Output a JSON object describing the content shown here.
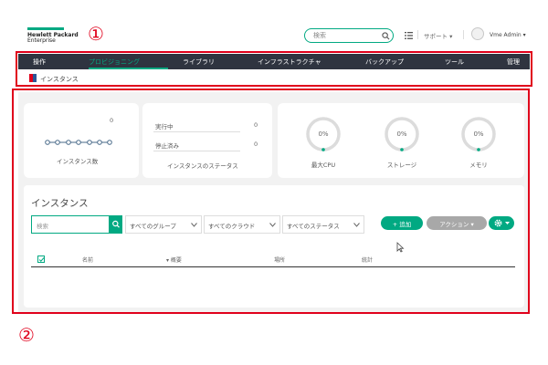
{
  "header": {
    "brand_line1": "Hewlett Packard",
    "brand_line2": "Enterprise",
    "marker_1": "①",
    "marker_2": "②",
    "search_placeholder": "検索",
    "support_label": "サポート ▾",
    "user_label": "Vme Admin ▾"
  },
  "nav": {
    "items": [
      "操作",
      "プロビジョニング",
      "ライブラリ",
      "インフラストラクチャ",
      "バックアップ",
      "ツール",
      "管理"
    ],
    "active": "プロビジョニング",
    "sub_item": "インスタンス"
  },
  "summary": {
    "instance_count": "0",
    "instance_count_label": "インスタンス数",
    "running_label": "実行中",
    "running_value": "0",
    "stopped_label": "停止済み",
    "stopped_value": "0",
    "status_label": "インスタンスのステータス",
    "gauges": [
      {
        "value": "0%",
        "label": "最大CPU",
        "fraction": 0
      },
      {
        "value": "0%",
        "label": "ストレージ",
        "fraction": 0
      },
      {
        "value": "0%",
        "label": "メモリ",
        "fraction": 0
      }
    ]
  },
  "instances": {
    "title": "インスタンス",
    "search_placeholder": "検索",
    "filters": [
      "すべてのグループ",
      "すべてのクラウド",
      "すべてのステータス"
    ],
    "add_label": "+ 追加",
    "action_label": "アクション ▾",
    "columns": [
      "名前",
      "▾ 概要",
      "場所",
      "統計"
    ]
  },
  "colors": {
    "accent": "#01a982",
    "nav_bg": "#2f3440",
    "highlight": "#e0001b",
    "content_bg": "#f2f2f2"
  },
  "icons": {
    "search": "search-icon",
    "list": "list-icon",
    "avatar": "avatar-icon",
    "gear": "gear-icon",
    "chevron": "chevron-down-icon",
    "instances": "instance-icon",
    "cursor": "mouse-cursor-icon"
  }
}
